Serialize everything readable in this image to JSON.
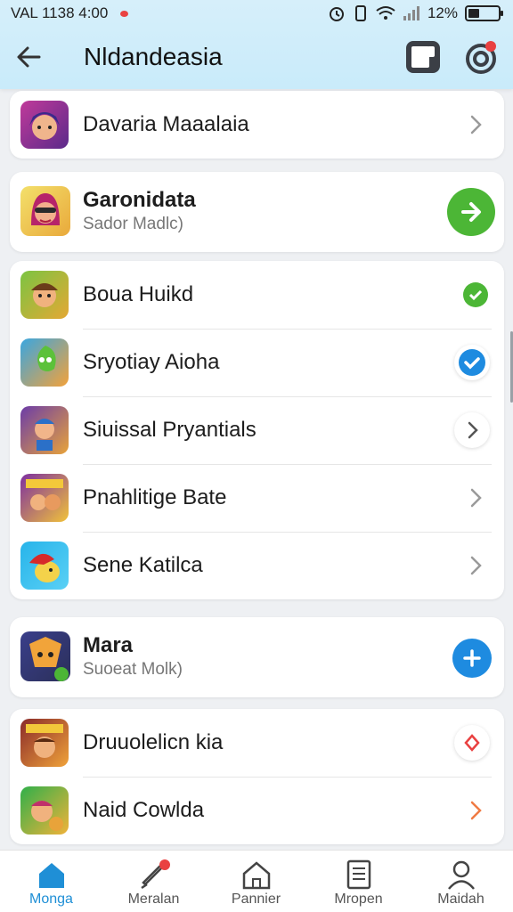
{
  "status": {
    "left_text": "VAL 1138 4:00",
    "battery": "12%"
  },
  "appbar": {
    "title": "Nldandeasia"
  },
  "cards": {
    "top": {
      "label": "Davaria Maaalaia"
    },
    "featured1": {
      "title": "Garonidata",
      "subtitle": "Sador Madlc)"
    },
    "group": [
      {
        "label": "Boua Huikd",
        "trail": "green-check"
      },
      {
        "label": "Sryotiay Aioha",
        "trail": "blue-check"
      },
      {
        "label": "Siuissal Pryantials",
        "trail": "chevron-ring"
      },
      {
        "label": "Pnahlitige Bate",
        "trail": "chevron"
      },
      {
        "label": "Sene Katilca",
        "trail": "chevron"
      }
    ],
    "featured2": {
      "title": "Mara",
      "subtitle": "Suoeat Molk)"
    },
    "bottom_group": [
      {
        "label": "Druuolelicn kia",
        "trail": "red-chevron-ring"
      },
      {
        "label": "Naid Cowlda",
        "trail": "orange-chevron"
      }
    ]
  },
  "bottomnav": [
    {
      "label": "Monga",
      "icon": "home-icon",
      "active": true
    },
    {
      "label": "Meralan",
      "icon": "rocket-icon",
      "active": false
    },
    {
      "label": "Pannier",
      "icon": "house-outline-icon",
      "active": false
    },
    {
      "label": "Mropen",
      "icon": "document-icon",
      "active": false
    },
    {
      "label": "Maidah",
      "icon": "person-icon",
      "active": false
    }
  ],
  "colors": {
    "accent_blue": "#1f8fd6",
    "green": "#4cb636",
    "blue_check": "#1e8be0",
    "red": "#e94141",
    "orange": "#f07b44"
  }
}
